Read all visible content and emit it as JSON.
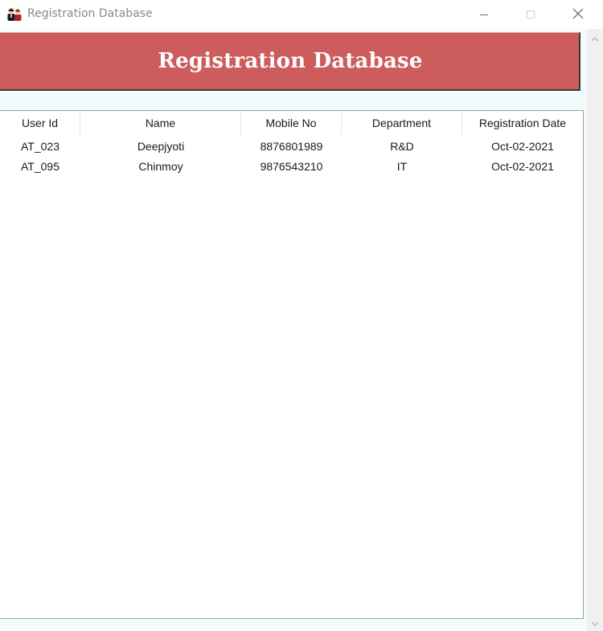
{
  "window": {
    "title": "Registration Database"
  },
  "header": {
    "title": "Registration Database",
    "background": "#cd5c5c"
  },
  "table": {
    "columns": [
      "User Id",
      "Name",
      "Mobile No",
      "Department",
      "Registration Date"
    ],
    "rows": [
      [
        "AT_023",
        "Deepjyoti",
        "8876801989",
        "R&D",
        "Oct-02-2021"
      ],
      [
        "AT_095",
        "Chinmoy",
        "9876543210",
        "IT",
        "Oct-02-2021"
      ]
    ]
  },
  "icons": {
    "app": "people-icon",
    "minimize": "minimize-icon",
    "maximize": "maximize-icon",
    "close": "close-icon",
    "scroll_up": "chevron-up-icon",
    "scroll_down": "chevron-down-icon"
  }
}
